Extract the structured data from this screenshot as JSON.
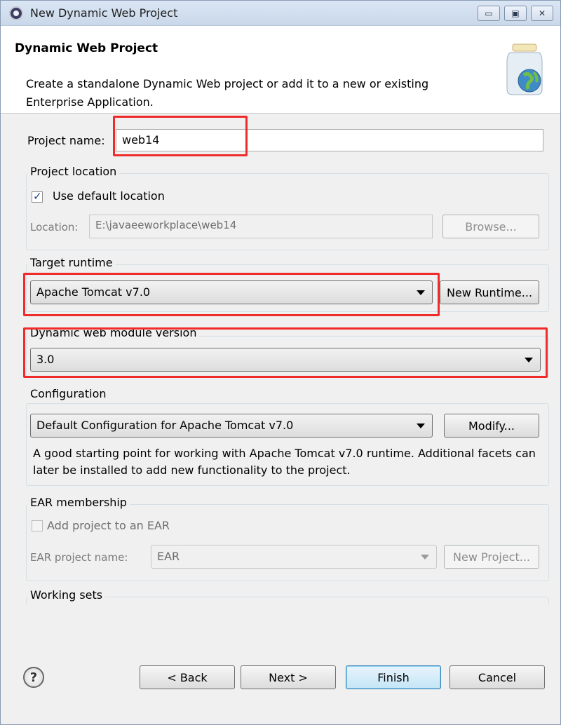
{
  "window": {
    "title": "New Dynamic Web Project",
    "controls": {
      "minimize": "▭",
      "maximize": "▣",
      "close": "✕"
    }
  },
  "banner": {
    "heading": "Dynamic Web Project",
    "description": "Create a standalone Dynamic Web project or add it to a new or existing Enterprise Application.",
    "icon": "web-project-jar-icon"
  },
  "project_name": {
    "label": "Project name:",
    "value": "web14"
  },
  "project_location": {
    "title": "Project location",
    "use_default_label": "Use default location",
    "use_default_checked": true,
    "location_label": "Location:",
    "location_value": "E:\\javaeeworkplace\\web14",
    "browse_label": "Browse..."
  },
  "target_runtime": {
    "title": "Target runtime",
    "selected": "Apache Tomcat v7.0",
    "new_runtime_label": "New Runtime..."
  },
  "module_version": {
    "title": "Dynamic web module version",
    "selected": "3.0"
  },
  "configuration": {
    "title": "Configuration",
    "selected": "Default Configuration for Apache Tomcat v7.0",
    "modify_label": "Modify...",
    "description": "A good starting point for working with Apache Tomcat v7.0 runtime. Additional facets can later be installed to add new functionality to the project."
  },
  "ear_membership": {
    "title": "EAR membership",
    "add_label": "Add project to an EAR",
    "add_checked": false,
    "name_label": "EAR project name:",
    "name_value": "EAR",
    "new_project_label": "New Project..."
  },
  "working_sets": {
    "title": "Working sets"
  },
  "buttons": {
    "help": "?",
    "back": "< Back",
    "next": "Next >",
    "finish": "Finish",
    "cancel": "Cancel"
  },
  "colors": {
    "highlight": "#f02b2b",
    "background": "#f0f0f0"
  }
}
